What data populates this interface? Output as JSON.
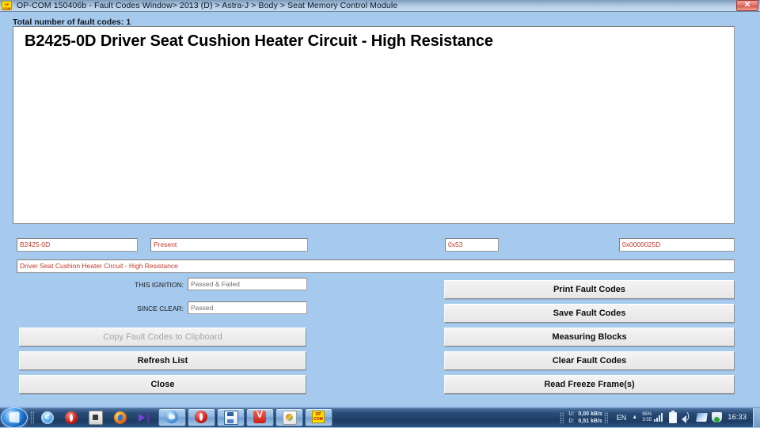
{
  "window": {
    "icon_label": "OP COM",
    "title": "OP-COM 150406b - Fault Codes Window> 2013 (D) > Astra-J > Body > Seat Memory Control Module",
    "close_label": "✕",
    "titlebar_color": "#95b1cd",
    "background_color": "#a6c9ee"
  },
  "header": {
    "total_label": "Total number of fault codes:",
    "total_count": "1"
  },
  "fault_list": {
    "items": [
      "B2425-0D Driver Seat Cushion Heater Circuit - High Resistance"
    ]
  },
  "details": {
    "code_value": "B2425-0D",
    "status_value": "Present",
    "hex_byte_value": "0x53",
    "hex_word_value": "0x0000025D",
    "description_value": "Driver Seat Cushion Heater Circuit - High Resistance",
    "this_ignition_label": "THIS IGNITION:",
    "this_ignition_value": "Passed & Failed",
    "since_clear_label": "SINCE CLEAR:",
    "since_clear_value": "Passed",
    "value_color": "#c0392b",
    "status_text_color": "#6f6f6f"
  },
  "left_buttons": {
    "copy_label": "Copy Fault Codes to Clipboard",
    "refresh_label": "Refresh List",
    "close_label": "Close"
  },
  "right_buttons": {
    "print_label": "Print Fault Codes",
    "save_label": "Save Fault Codes",
    "measuring_label": "Measuring Blocks",
    "clear_label": "Clear Fault Codes",
    "freeze_label": "Read Freeze Frame(s)"
  },
  "taskbar": {
    "start_label": "Start",
    "quick_launch": [
      "internet-explorer-icon",
      "opera-icon",
      "application-icon",
      "firefox-icon",
      "media-player-icon"
    ],
    "tasks": [
      "globe-icon",
      "opera-icon",
      "save-icon",
      "vivaldi-icon",
      "paint-icon",
      "opcom-icon"
    ],
    "opcom_task_label": "OP COM",
    "vivaldi_letter": "V",
    "tray": {
      "upload_key": "U:",
      "upload_value": "0,00 kB/s",
      "download_key": "D:",
      "download_value": "0,51 kB/s",
      "language": "EN",
      "overflow_arrow": "▲",
      "battery_percent": "95%",
      "battery_time": "3:55",
      "clock": "16:33"
    }
  }
}
